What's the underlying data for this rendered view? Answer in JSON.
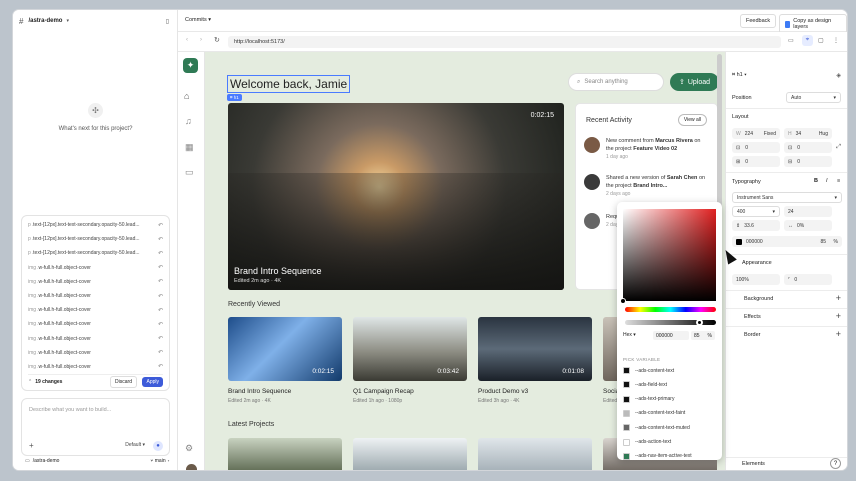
{
  "left_panel": {
    "project": "/astra-demo",
    "empty_prompt": "What's next for this project?",
    "changes": [
      {
        "kind": "p",
        "text": "text-[12px].text-text-secondary.opacity-50.lead..."
      },
      {
        "kind": "p",
        "text": "text-[12px].text-text-secondary.opacity-50.lead..."
      },
      {
        "kind": "p",
        "text": "text-[12px].text-text-secondary.opacity-50.lead..."
      },
      {
        "kind": "img",
        "text": "w-full.h-full.object-cover"
      },
      {
        "kind": "img",
        "text": "w-full.h-full.object-cover"
      },
      {
        "kind": "img",
        "text": "w-full.h-full.object-cover"
      },
      {
        "kind": "img",
        "text": "w-full.h-full.object-cover"
      },
      {
        "kind": "img",
        "text": "w-full.h-full.object-cover"
      },
      {
        "kind": "img",
        "text": "w-full.h-full.object-cover"
      },
      {
        "kind": "img",
        "text": "w-full.h-full.object-cover"
      },
      {
        "kind": "img",
        "text": "w-full.h-full.object-cover"
      }
    ],
    "change_count": "19 changes",
    "discard": "Discard",
    "apply": "Apply",
    "prompt_placeholder": "Describe what you want to build...",
    "model": "Default",
    "footer_repo": "/astra-demo",
    "footer_branch": "main"
  },
  "topbar": {
    "commits": "Commits",
    "feedback": "Feedback",
    "copy_design": "Copy as design layers"
  },
  "url": "http://localhost:5173/",
  "site": {
    "welcome": "Welcome back, Jamie",
    "tag": "h1",
    "search_placeholder": "Search anything",
    "upload": "Upload",
    "hero": {
      "title": "Brand Intro Sequence",
      "sub": "Edited 2m ago · 4K",
      "duration": "0:02:15"
    },
    "recent_activity": {
      "title": "Recent Activity",
      "view_all": "View all",
      "items": [
        {
          "pre": "New comment from ",
          "b1": "Marcus Rivera",
          "mid": " on the project ",
          "b2": "Feature Video 02",
          "time": "1 day ago"
        },
        {
          "pre": "Shared a new version of ",
          "b1": "Sarah Chen",
          "mid": " on the project ",
          "b2": "Brand Intro...",
          "time": "2 days ago"
        },
        {
          "pre": "Reques",
          "b1": "",
          "mid": "on the p",
          "b2": "",
          "time": "2 days ag"
        }
      ]
    },
    "recently_viewed": "Recently Viewed",
    "videos": [
      {
        "title": "Brand Intro Sequence",
        "sub": "Edited 2m ago · 4K",
        "duration": "0:02:15"
      },
      {
        "title": "Q1 Campaign Recap",
        "sub": "Edited 1h ago · 1080p",
        "duration": "0:03:42"
      },
      {
        "title": "Product Demo v3",
        "sub": "Edited 3h ago · 4K",
        "duration": "0:01:08"
      },
      {
        "title": "Social F",
        "sub": "Edited 2",
        "duration": ""
      }
    ],
    "latest_projects": "Latest Projects"
  },
  "inspector": {
    "tag": "h1",
    "position_label": "Position",
    "position_value": "Auto",
    "layout_label": "Layout",
    "w_label": "W",
    "w_value": "224",
    "w_mode": "Fixed",
    "h_label": "H",
    "h_value": "34",
    "h_mode": "Hug",
    "pad1": "0",
    "pad2": "0",
    "pad3": "0",
    "pad4": "0",
    "typography_label": "Typography",
    "font": "Instrument Sans",
    "weight": "400",
    "size": "24",
    "line_height": "33.6",
    "letter_spacing": "0%",
    "color_hex": "000000",
    "color_opacity": "85",
    "pct": "%",
    "appearance_label": "Appearance",
    "opacity": "100%",
    "radius": "0",
    "background_label": "Background",
    "effects_label": "Effects",
    "border_label": "Border",
    "elements_label": "Elements"
  },
  "color_picker": {
    "mode": "Hex",
    "hex": "000000",
    "opacity": "85",
    "pct": "%",
    "pick_variable": "PICK VARIABLE",
    "variables": [
      {
        "name": "--ads-content-text",
        "color": "#111111"
      },
      {
        "name": "--ads-field-text",
        "color": "#111111"
      },
      {
        "name": "--ads-text-primary",
        "color": "#111111"
      },
      {
        "name": "--ads-content-text-faint",
        "color": "#bbbbbb"
      },
      {
        "name": "--ads-content-text-muted",
        "color": "#666666"
      },
      {
        "name": "--ads-action-text",
        "color": "#ffffff"
      },
      {
        "name": "--ads-nav-item-active-text",
        "color": "#2f7a55"
      }
    ]
  },
  "colors": {
    "accent": "#2f7a55",
    "apply": "#3d5bd9",
    "canvas": "#e4ecdf"
  }
}
